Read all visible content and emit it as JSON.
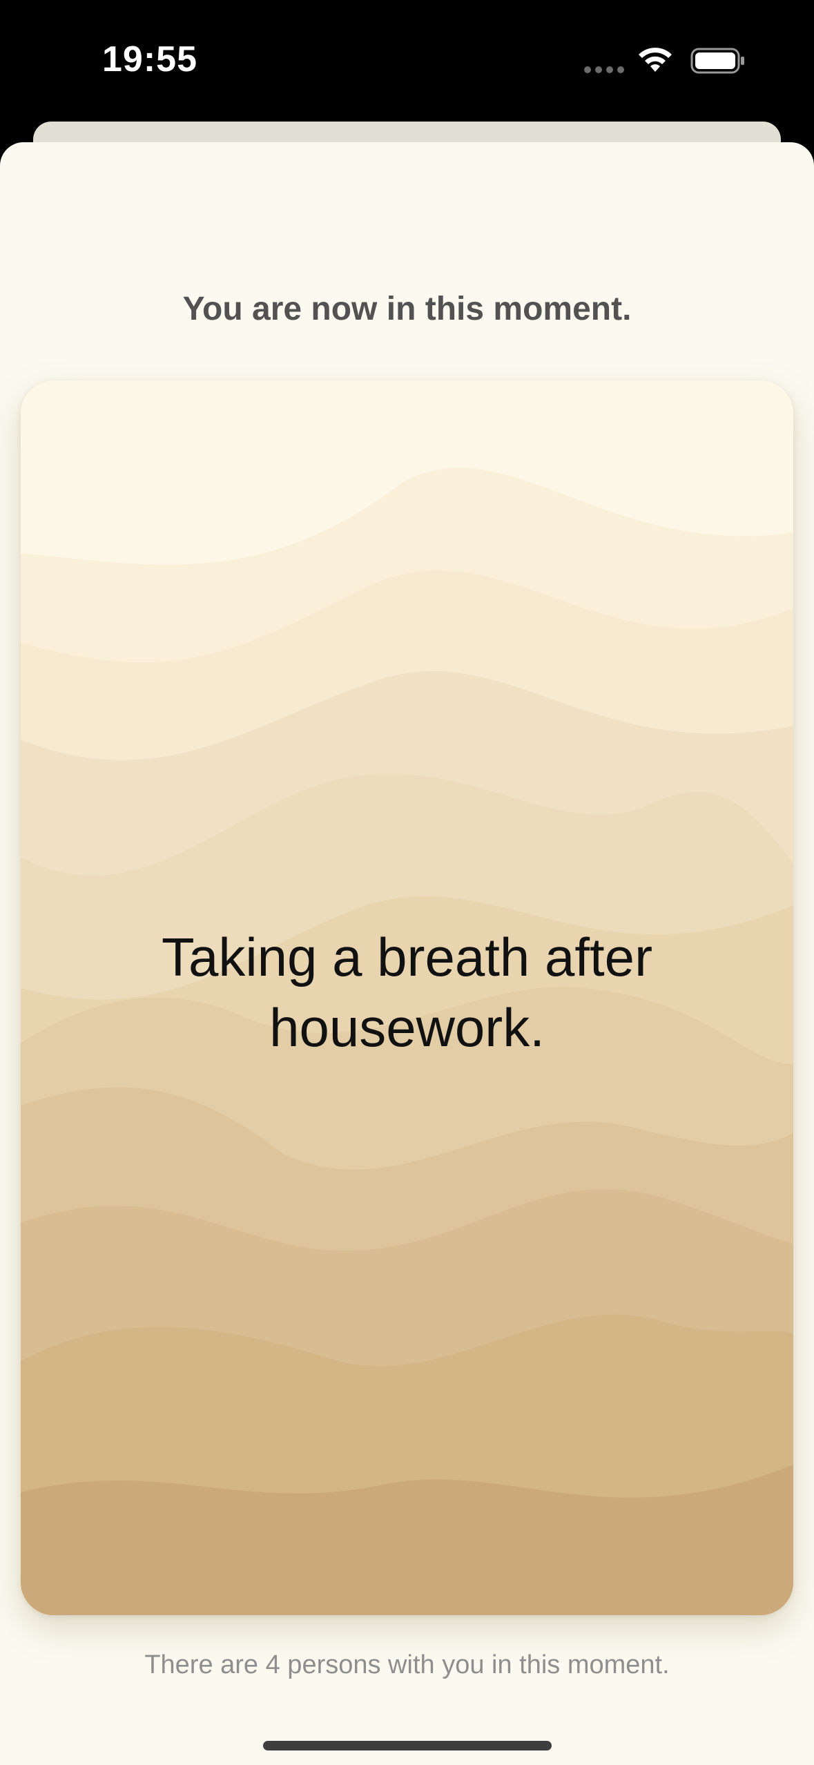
{
  "status_bar": {
    "time": "19:55",
    "icons": [
      "signal-dots-icon",
      "wifi-icon",
      "battery-icon"
    ]
  },
  "sheet": {
    "heading": "You are now in this moment.",
    "moment_text": "Taking a breath after housework.",
    "companions_text": "There are 4 persons with you in this moment."
  },
  "colors": {
    "sheet_background": "#fcfaf0",
    "heading_text": "#525252",
    "wave_top": "#fdf7e7",
    "wave_bottom": "#cba97a"
  }
}
